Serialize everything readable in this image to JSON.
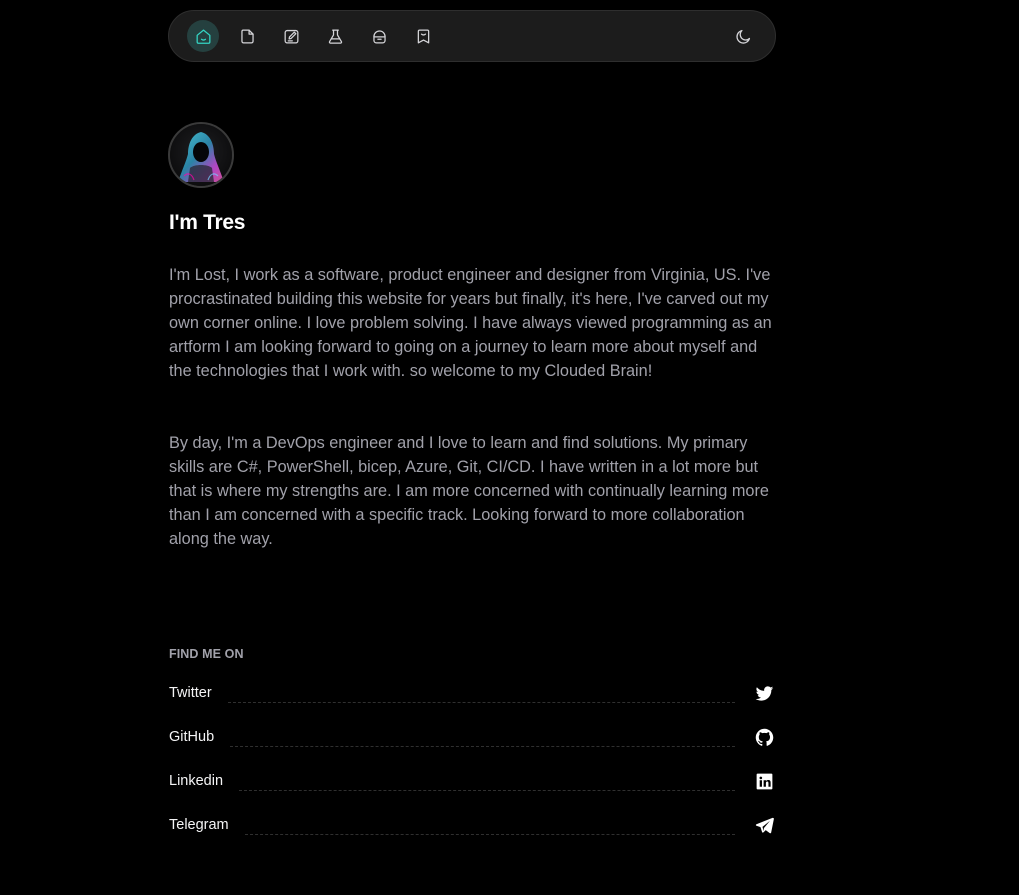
{
  "nav": {
    "items": [
      {
        "name": "home",
        "icon": "home-icon",
        "active": true
      },
      {
        "name": "notes",
        "icon": "file-icon",
        "active": false
      },
      {
        "name": "blog",
        "icon": "edit-icon",
        "active": false
      },
      {
        "name": "lab",
        "icon": "flask-icon",
        "active": false
      },
      {
        "name": "stack",
        "icon": "bag-icon",
        "active": false
      },
      {
        "name": "bookmarks",
        "icon": "bookmark-icon",
        "active": false
      }
    ],
    "theme_toggle_icon": "moon-icon",
    "accent_color": "#34d5c4"
  },
  "profile": {
    "title": "I'm Tres",
    "bio": [
      "I'm Lost, I work as a software, product engineer and designer from Virginia, US. I've procrastinated building this website for years but finally, it's here, I've carved out my own corner online. I love problem solving. I have always viewed programming as an artform I am looking forward to going on a journey to learn more about myself and the technologies that I work with. so welcome to my Clouded Brain!",
      "By day, I'm a DevOps engineer and I love to learn and find solutions. My primary skills are C#, PowerShell, bicep, Azure, Git, CI/CD. I have written in a lot more but that is where my strengths are. I am more concerned with continually learning more than I am concerned with a specific track. Looking forward to more collaboration along the way."
    ]
  },
  "social": {
    "heading": "FIND ME ON",
    "links": [
      {
        "label": "Twitter",
        "icon": "twitter-icon"
      },
      {
        "label": "GitHub",
        "icon": "github-icon"
      },
      {
        "label": "Linkedin",
        "icon": "linkedin-icon"
      },
      {
        "label": "Telegram",
        "icon": "telegram-icon"
      }
    ]
  }
}
